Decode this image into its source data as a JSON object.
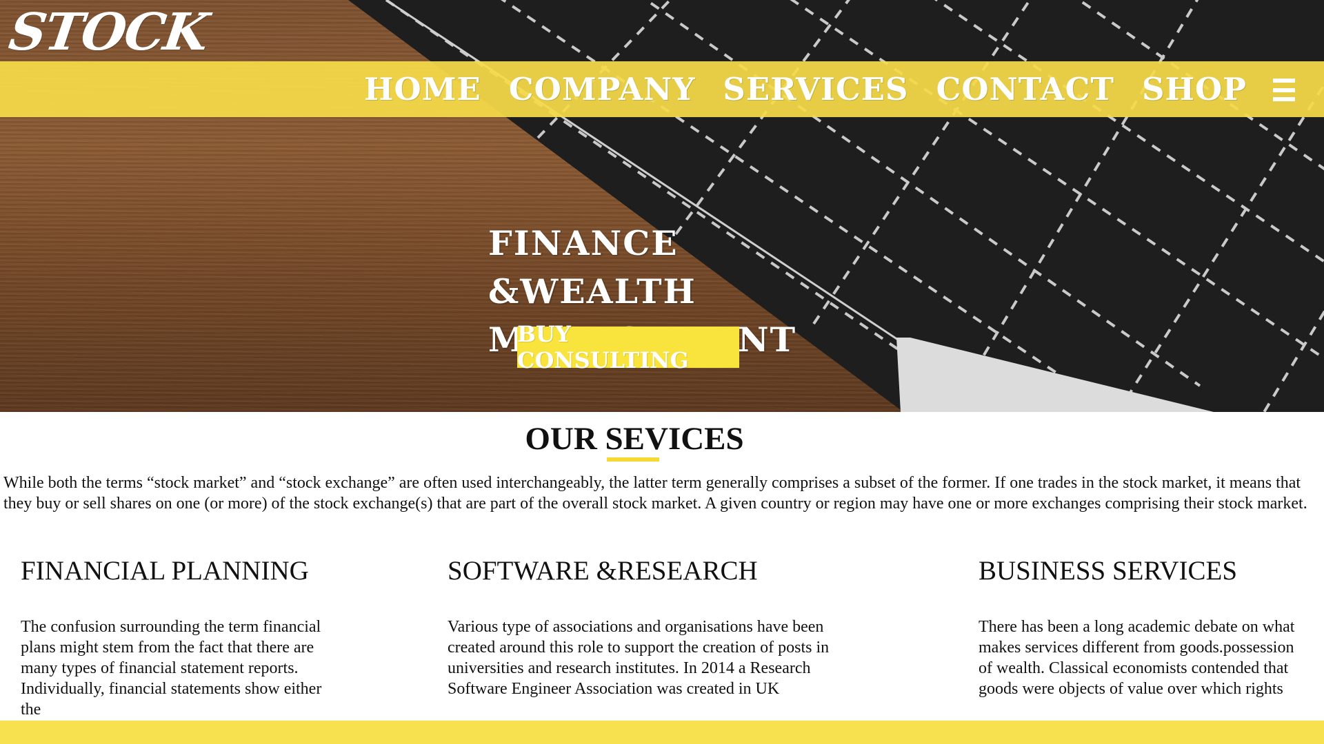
{
  "brand": {
    "logo_text": "STOCK"
  },
  "nav": {
    "items": [
      "HOME",
      "COMPANY",
      "SERVICES",
      "CONTACT",
      "SHOP"
    ],
    "menu_icon": "hamburger-icon"
  },
  "hero": {
    "title_line1": "FINANCE &WEALTH",
    "title_line2": "MANAGEMENT",
    "cta_label": "BUY CONSULTING"
  },
  "services": {
    "title": "OUR SEVICES",
    "intro": "While both the terms “stock market” and “stock exchange” are often used interchangeably, the latter term generally comprises a subset of the former. If one trades in the stock market, it means that they buy or sell shares on one (or more) of the stock exchange(s) that are part of the overall stock market. A given country or region may have one or more exchanges comprising their stock market.",
    "columns": [
      {
        "heading": "FINANCIAL PLANNING",
        "text": "The confusion surrounding the term financial plans might stem from the fact that there are many types of financial statement reports. Individually, financial statements show either the"
      },
      {
        "heading": "SOFTWARE &RESEARCH",
        "text": "Various type of associations and organisations have been created around this role to support the creation of posts in universities and research institutes. In 2014 a Research Software Engineer Association was created in UK"
      },
      {
        "heading": "BUSINESS SERVICES",
        "text": "There has been a long academic debate on what makes services different from goods.possession of wealth. Classical economists contended that goods were objects of value over which rights"
      }
    ]
  },
  "colors": {
    "accent_yellow": "#f5da48",
    "cta_yellow": "#f8e43c",
    "board_dark": "#1e1e1e",
    "wood": "#7c5131"
  }
}
